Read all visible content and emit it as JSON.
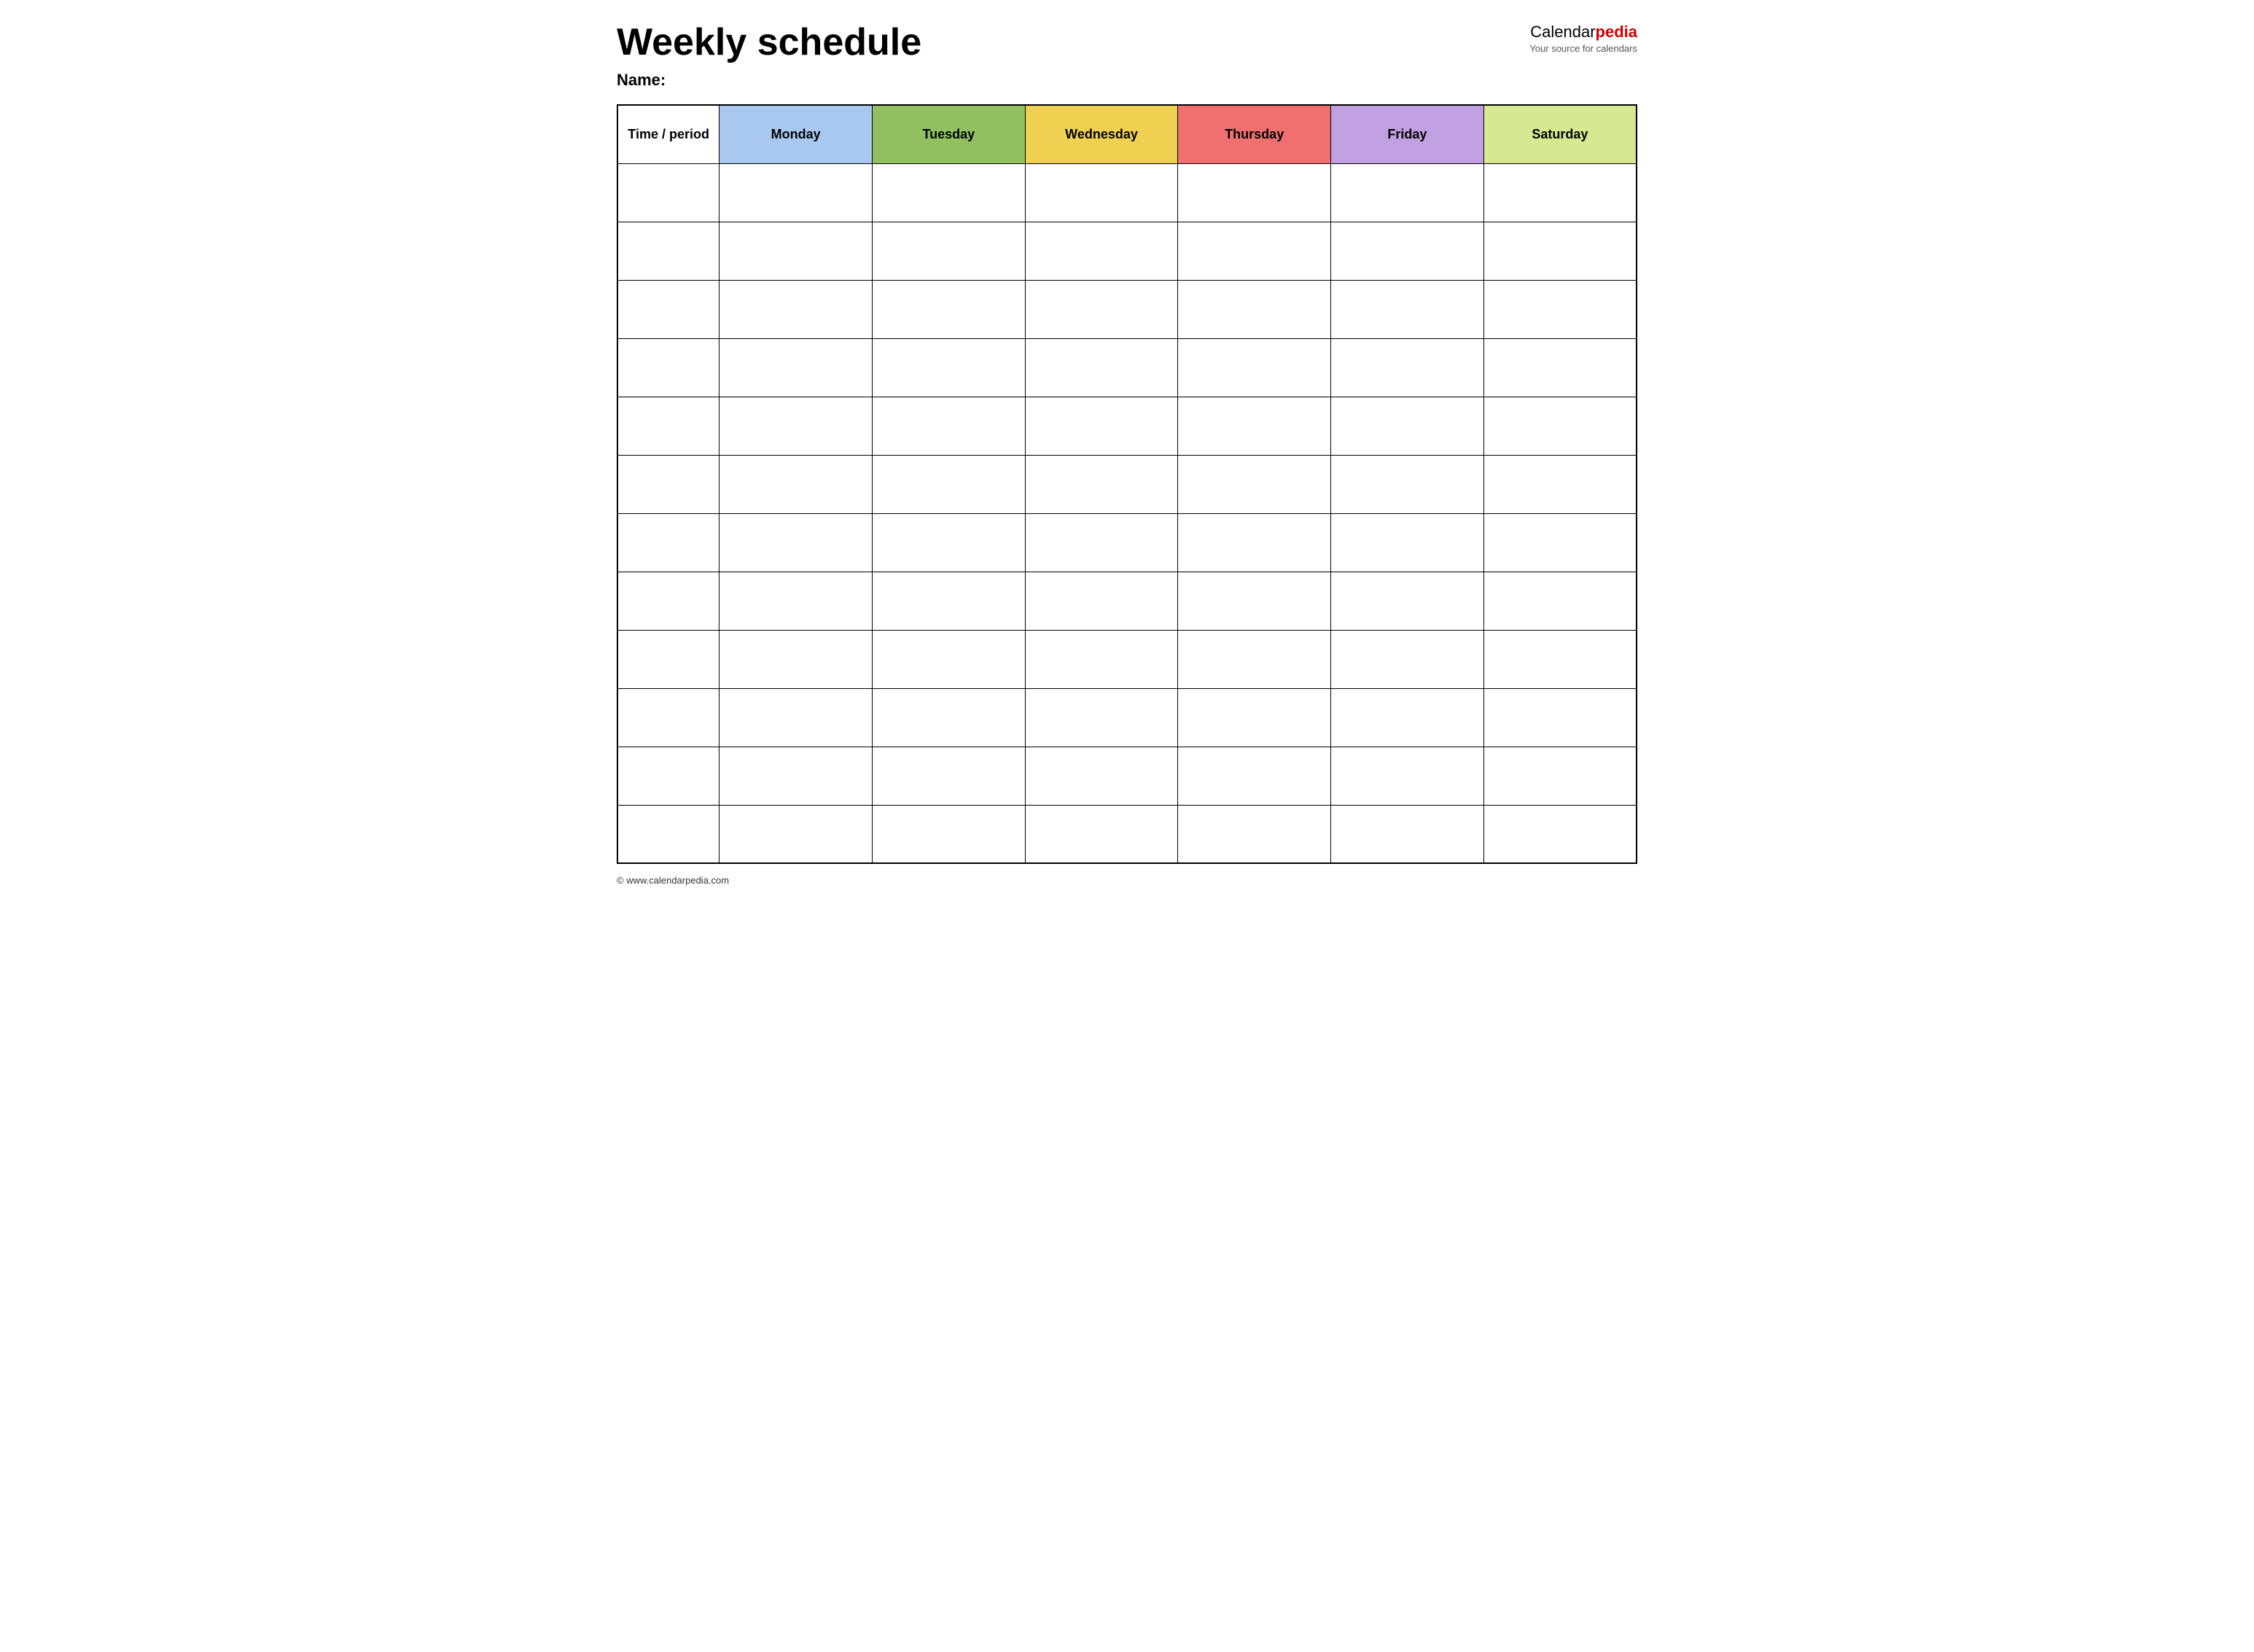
{
  "header": {
    "title": "Weekly schedule",
    "name_label": "Name:",
    "logo": {
      "calendar_part": "Calendar",
      "pedia_part": "pedia",
      "subtitle": "Your source for calendars"
    }
  },
  "table": {
    "columns": [
      {
        "id": "time",
        "label": "Time / period",
        "color": "#ffffff"
      },
      {
        "id": "monday",
        "label": "Monday",
        "color": "#a8c8f0"
      },
      {
        "id": "tuesday",
        "label": "Tuesday",
        "color": "#90c060"
      },
      {
        "id": "wednesday",
        "label": "Wednesday",
        "color": "#f0d050"
      },
      {
        "id": "thursday",
        "label": "Thursday",
        "color": "#f07070"
      },
      {
        "id": "friday",
        "label": "Friday",
        "color": "#c0a0e0"
      },
      {
        "id": "saturday",
        "label": "Saturday",
        "color": "#d8e890"
      }
    ],
    "rows": 12
  },
  "footer": {
    "url": "© www.calendarpedia.com"
  }
}
